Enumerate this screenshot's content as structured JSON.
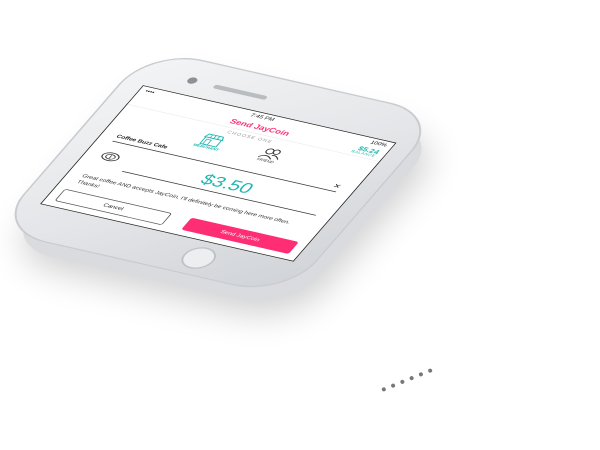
{
  "statusbar": {
    "signal": "•••• ",
    "time": "7:45 PM",
    "battery": "100%"
  },
  "header": {
    "title": "Send JayCoin",
    "balance": "$5.24",
    "balance_label": "BALANCE"
  },
  "chooser": {
    "label": "CHOOSE ONE",
    "options": [
      {
        "label": "MERCHANT",
        "icon": "store-icon",
        "selected": true
      },
      {
        "label": "FRIEND",
        "icon": "friends-icon",
        "selected": false
      }
    ]
  },
  "recipient": {
    "name": "Coffee Buzz Cafe",
    "clear_icon": "close-icon"
  },
  "amount": {
    "value": "$3.50",
    "icon": "coin-icon"
  },
  "message": {
    "text": "Great coffee AND accepts JayCoin. I'll definitely be coming here more often. Thanks!"
  },
  "buttons": {
    "cancel": "Cancel",
    "send": "Send JayCoin"
  },
  "colors": {
    "accent_pink": "#ff2d73",
    "accent_teal": "#1fb8b0"
  }
}
